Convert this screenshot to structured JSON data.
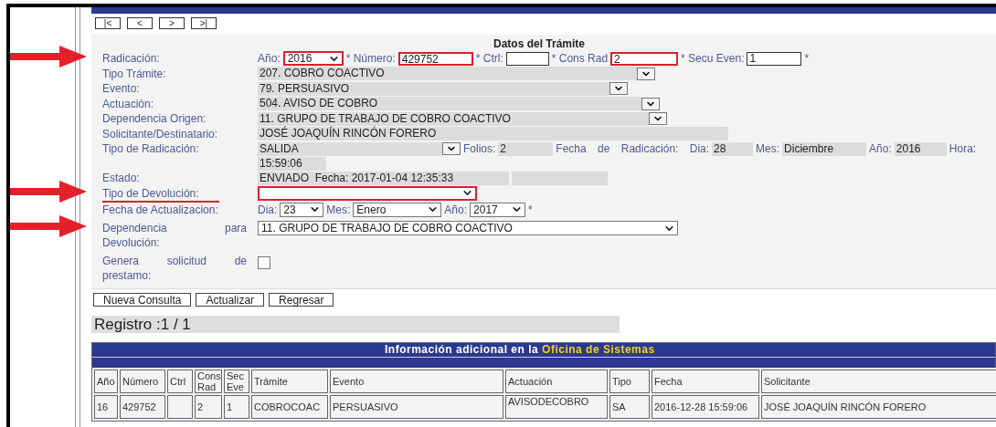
{
  "nav_buttons": [
    "|<",
    "<",
    ">",
    ">|"
  ],
  "form": {
    "title": "Datos del Trámite",
    "rows": [
      {
        "label": "Radicación:",
        "arrow": true,
        "underlined": false,
        "parts": [
          {
            "kind": "text",
            "value": "Año:"
          },
          {
            "kind": "select",
            "value": "2016",
            "highlighted": true
          },
          {
            "kind": "text",
            "value": "* Número:"
          },
          {
            "kind": "input",
            "value": "429752",
            "highlighted": true
          },
          {
            "kind": "text",
            "value": "* Ctrl:"
          },
          {
            "kind": "input",
            "highlighted": false
          },
          {
            "kind": "text",
            "value": "* Cons Rad"
          },
          {
            "kind": "input",
            "value": "2",
            "highlighted": true
          },
          {
            "kind": "text",
            "value": "* Secu Even:"
          },
          {
            "kind": "input",
            "value": "1",
            "highlighted": false
          },
          {
            "kind": "text",
            "value": "*"
          }
        ]
      },
      {
        "label": "Tipo Trámite:",
        "arrow": false,
        "underlined": false,
        "parts": [
          {
            "kind": "readonly_select",
            "value": "207. COBRO COACTIVO"
          }
        ]
      },
      {
        "label": "Evento:",
        "arrow": false,
        "underlined": false,
        "parts": [
          {
            "kind": "readonly_select",
            "value": "79. PERSUASIVO"
          }
        ]
      },
      {
        "label": "Actuación:",
        "arrow": false,
        "underlined": false,
        "parts": [
          {
            "kind": "readonly_select",
            "value": "504. AVISO DE COBRO"
          }
        ]
      },
      {
        "label": "Dependencia Origen:",
        "arrow": false,
        "underlined": false,
        "parts": [
          {
            "kind": "readonly_select",
            "value": "11. GRUPO DE TRABAJO DE COBRO COACTIVO"
          }
        ]
      },
      {
        "label": "Solicitante/Destinatario:",
        "arrow": false,
        "underlined": false,
        "parts": [
          {
            "kind": "readonly",
            "value": "JOSÉ JOAQUÍN RINCÓN FORERO"
          }
        ]
      },
      {
        "label": "Tipo de Radicación:",
        "arrow": false,
        "underlined": false,
        "parts": [
          {
            "kind": "readonly_select",
            "value": "SALIDA"
          },
          {
            "kind": "text",
            "value": "Folios:"
          },
          {
            "kind": "readonly",
            "value": "2"
          },
          {
            "kind": "text",
            "value": "Fecha de Radicación: Dia:"
          },
          {
            "kind": "readonly",
            "value": "28"
          },
          {
            "kind": "text",
            "value": "Mes:"
          },
          {
            "kind": "readonly",
            "value": "Diciembre"
          },
          {
            "kind": "text",
            "value": "Año:"
          },
          {
            "kind": "readonly",
            "value": "2016"
          },
          {
            "kind": "text",
            "value": "Hora:"
          },
          {
            "kind": "readonly",
            "value": "15:59:06"
          }
        ]
      },
      {
        "label": "Estado:",
        "arrow": false,
        "underlined": false,
        "parts": [
          {
            "kind": "readonly",
            "value": "ENVIADO  Fecha: 2017-01-04 12:35:33"
          },
          {
            "kind": "readonly"
          }
        ]
      },
      {
        "label": "Tipo de Devolución:",
        "arrow": true,
        "underlined": true,
        "parts": [
          {
            "kind": "select",
            "highlighted": true
          }
        ]
      },
      {
        "label": "Fecha de Actualizacion:",
        "arrow": false,
        "underlined": false,
        "parts": [
          {
            "kind": "text",
            "value": "Dia:"
          },
          {
            "kind": "select",
            "value": "23",
            "highlighted": false
          },
          {
            "kind": "text",
            "value": "Mes:"
          },
          {
            "kind": "select",
            "value": "Enero",
            "highlighted": false
          },
          {
            "kind": "text",
            "value": "Año:"
          },
          {
            "kind": "select",
            "value": "2017",
            "highlighted": false
          },
          {
            "kind": "text",
            "value": "*"
          }
        ]
      },
      {
        "label": "Dependencia para Devolución:",
        "arrow": true,
        "underlined": false,
        "parts": [
          {
            "kind": "select",
            "value": "11. GRUPO DE TRABAJO DE COBRO COACTIVO",
            "highlighted": false
          }
        ]
      },
      {
        "label": "Genera solicitud de prestamo:",
        "arrow": false,
        "underlined": false,
        "parts": [
          {
            "kind": "checkbox",
            "checked": false
          }
        ]
      }
    ]
  },
  "actions": [
    "Nueva Consulta",
    "Actualizar",
    "Regresar"
  ],
  "registro": "Registro :1 / 1",
  "table": {
    "title": "Información adicional en la ",
    "title_highlight": "Oficina de Sistemas",
    "columns": [
      "Año",
      "Número",
      "Ctrl",
      "Cons Rad",
      "Sec Eve",
      "Trámite",
      "Evento",
      "Actuación",
      "Tipo",
      "Fecha",
      "Solicitante"
    ],
    "rows": [
      [
        "16",
        "429752",
        null,
        "2",
        "1",
        "COBROCOAC",
        "PERSUASIVO",
        "AVISODECOBRO",
        "SA",
        "2016-12-28 15:59:06",
        "JOSÉ JOAQUÍN RINCÓN FORERO"
      ]
    ]
  }
}
